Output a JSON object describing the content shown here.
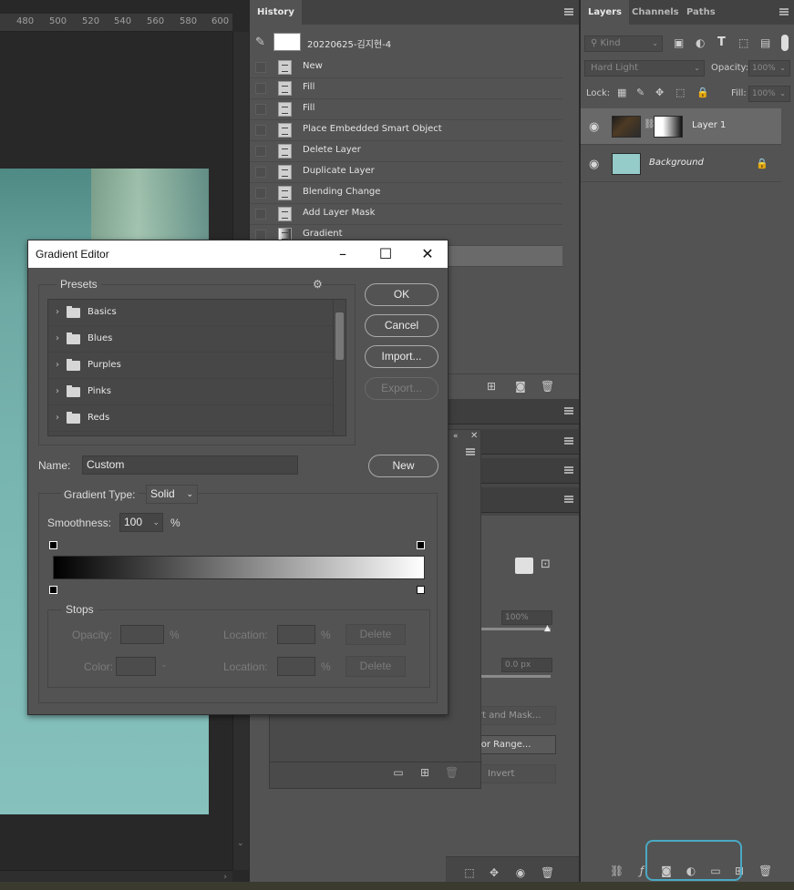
{
  "ruler": {
    "ticks": [
      "480",
      "500",
      "520",
      "540",
      "560",
      "580",
      "600"
    ]
  },
  "history": {
    "tab_label": "History",
    "snapshot_label": "20220625-김지현-4",
    "items": [
      {
        "label": "New"
      },
      {
        "label": "Fill"
      },
      {
        "label": "Fill"
      },
      {
        "label": "Place Embedded Smart Object"
      },
      {
        "label": "Delete Layer"
      },
      {
        "label": "Duplicate Layer"
      },
      {
        "label": "Blending Change"
      },
      {
        "label": "Add Layer Mask"
      },
      {
        "label": "Gradient"
      }
    ]
  },
  "layers": {
    "tabs": [
      "Layers",
      "Channels",
      "Paths"
    ],
    "kind_placeholder": "Kind",
    "blend_mode": "Hard Light",
    "opacity_label": "Opacity:",
    "opacity_value": "100%",
    "lock_label": "Lock:",
    "fill_label": "Fill:",
    "fill_value": "100%",
    "items": [
      {
        "name": "Layer 1"
      },
      {
        "name": "Background"
      }
    ]
  },
  "properties": {
    "density_value": "100%",
    "feather_value": "0.0 px",
    "select_mask_label": "rt and Mask...",
    "color_range_label": "lor Range...",
    "invert_label": "Invert"
  },
  "gradient_editor": {
    "title": "Gradient Editor",
    "presets_label": "Presets",
    "presets": [
      {
        "name": "Basics"
      },
      {
        "name": "Blues"
      },
      {
        "name": "Purples"
      },
      {
        "name": "Pinks"
      },
      {
        "name": "Reds"
      }
    ],
    "buttons": {
      "ok": "OK",
      "cancel": "Cancel",
      "import": "Import...",
      "export": "Export...",
      "new": "New"
    },
    "name_label": "Name:",
    "name_value": "Custom",
    "gradient_type_label": "Gradient Type:",
    "gradient_type_value": "Solid",
    "smoothness_label": "Smoothness:",
    "smoothness_value": "100",
    "smoothness_unit": "%",
    "stops_label": "Stops",
    "stops": {
      "opacity_label": "Opacity:",
      "percent": "%",
      "location_label": "Location:",
      "color_label": "Color:",
      "delete_label": "Delete"
    },
    "gradient_colors": {
      "start": "#000000",
      "end": "#ffffff"
    }
  },
  "colors": {
    "highlight": "#4aa9c4",
    "panel_bg": "#535353",
    "canvas_bg": "#282828"
  }
}
